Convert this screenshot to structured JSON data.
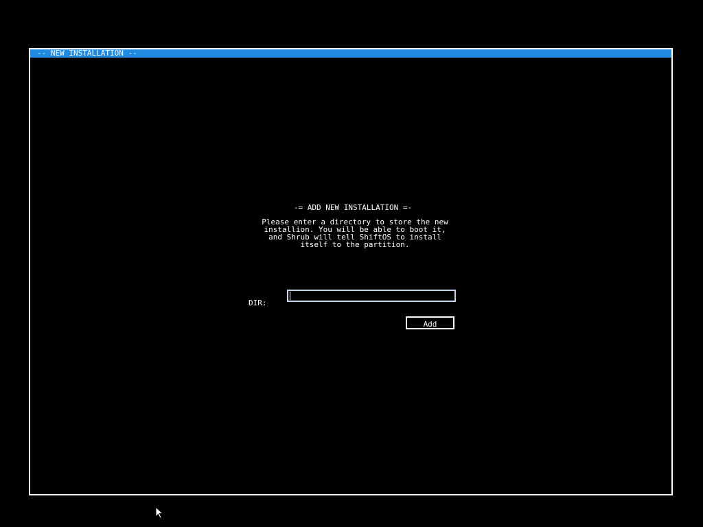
{
  "window": {
    "title": "-- NEW INSTALLATION --",
    "titlebar_color": "#1f8ae0",
    "border_color": "#ffffff",
    "background_color": "#000000"
  },
  "dialog": {
    "heading": "-= ADD NEW INSTALLATION =-",
    "description_lines": [
      "Please enter a directory to store the new",
      "installion. You will be able to boot it,",
      "and Shrub will tell ShiftOS to install",
      "itself to the partition."
    ],
    "dir_label": "DIR:",
    "dir_value": "",
    "add_button_label": "Add"
  },
  "pointer": {
    "icon": "arrow-cursor-icon"
  }
}
